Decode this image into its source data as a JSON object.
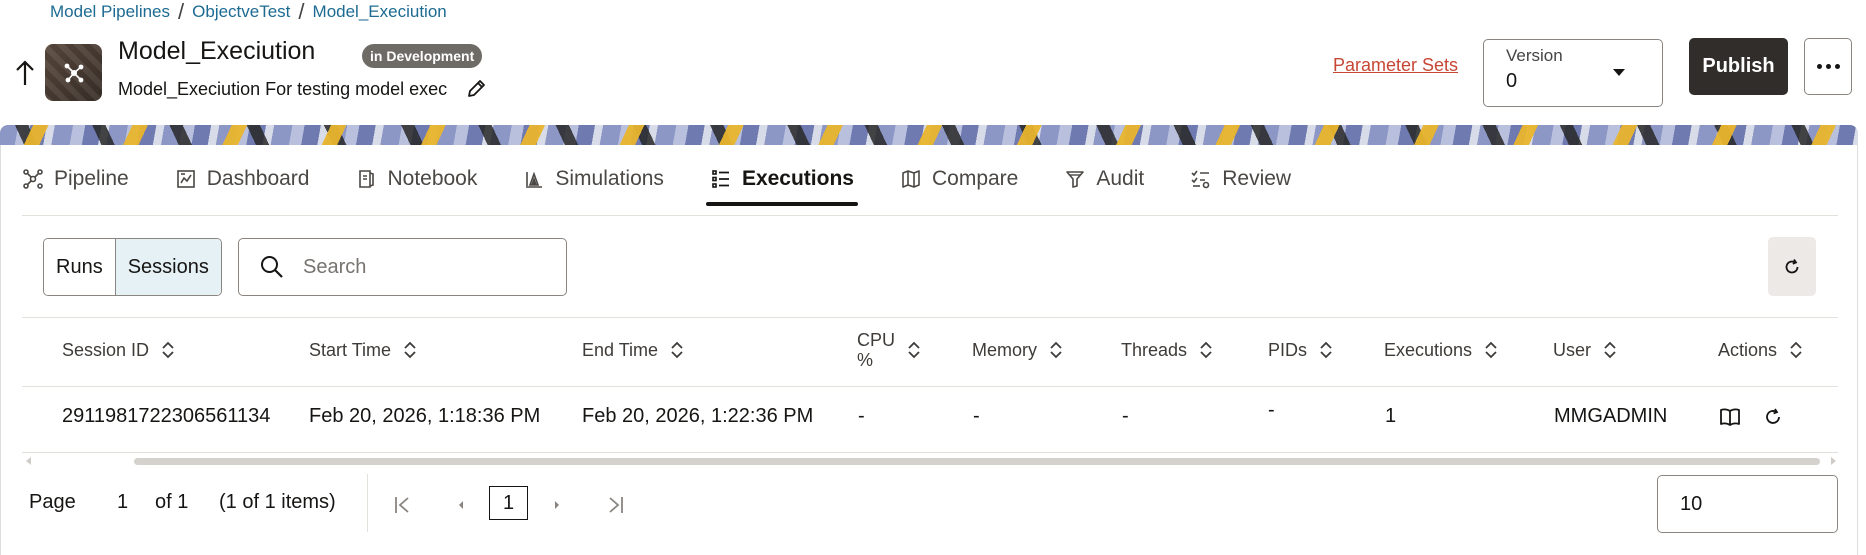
{
  "breadcrumb": [
    "Model Pipelines",
    "ObjectveTest",
    "Model_Execiution"
  ],
  "header": {
    "title": "Model_Execiution",
    "status_badge": "in Development",
    "description": "Model_Execiution For testing model exec",
    "parameter_sets_link": "Parameter Sets",
    "version_label": "Version",
    "version_value": "0",
    "publish_label": "Publish"
  },
  "tabs": [
    {
      "label": "Pipeline",
      "icon": "pipeline-icon"
    },
    {
      "label": "Dashboard",
      "icon": "dashboard-icon"
    },
    {
      "label": "Notebook",
      "icon": "notebook-icon"
    },
    {
      "label": "Simulations",
      "icon": "simulations-icon"
    },
    {
      "label": "Executions",
      "icon": "executions-icon",
      "active": true
    },
    {
      "label": "Compare",
      "icon": "compare-icon"
    },
    {
      "label": "Audit",
      "icon": "audit-icon"
    },
    {
      "label": "Review",
      "icon": "review-icon"
    }
  ],
  "toolbar": {
    "runs_label": "Runs",
    "sessions_label": "Sessions",
    "selected_view": "Sessions",
    "search_placeholder": "Search"
  },
  "table": {
    "columns": [
      "Session ID",
      "Start Time",
      "End Time",
      "CPU\n%",
      "Memory",
      "Threads",
      "PIDs",
      "Executions",
      "User",
      "Actions"
    ],
    "rows": [
      {
        "session_id": "2911981722306561134",
        "start_time": "Feb 20, 2026, 1:18:36 PM",
        "end_time": "Feb 20, 2026, 1:22:36 PM",
        "cpu": "-",
        "memory": "-",
        "threads": "-",
        "pids": "-",
        "executions": "1",
        "user": "MMGADMIN"
      }
    ]
  },
  "pagination": {
    "page_label": "Page",
    "page_value": "1",
    "of_label": "of 1",
    "items_summary": "(1 of 1 items)",
    "current_page": "1",
    "page_size": "10"
  },
  "colors": {
    "link": "#1d6b92",
    "parameter_sets_link": "#c74634",
    "primary_button": "#312d2a",
    "selected_segment": "#e6f1f6",
    "badge": "#6e6a66"
  }
}
